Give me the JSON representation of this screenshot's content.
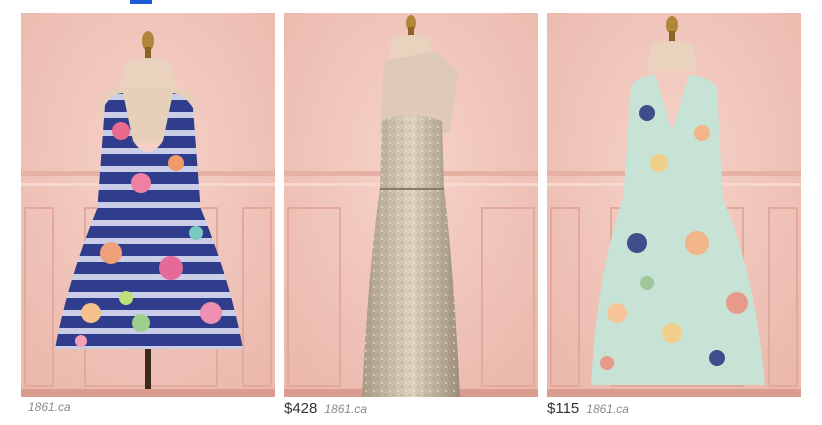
{
  "products": [
    {
      "price": "",
      "source": "1861.ca",
      "dress_icon": "floral-striped-dress-icon"
    },
    {
      "price": "$428",
      "source": "1861.ca",
      "dress_icon": "sequin-gown-icon"
    },
    {
      "price": "$115",
      "source": "1861.ca",
      "dress_icon": "floral-mint-dress-icon"
    }
  ],
  "colors": {
    "accent": "#1e5bd6",
    "wall": "#f2c8c0",
    "price_text": "#333333",
    "source_text": "#8a8a8a"
  }
}
